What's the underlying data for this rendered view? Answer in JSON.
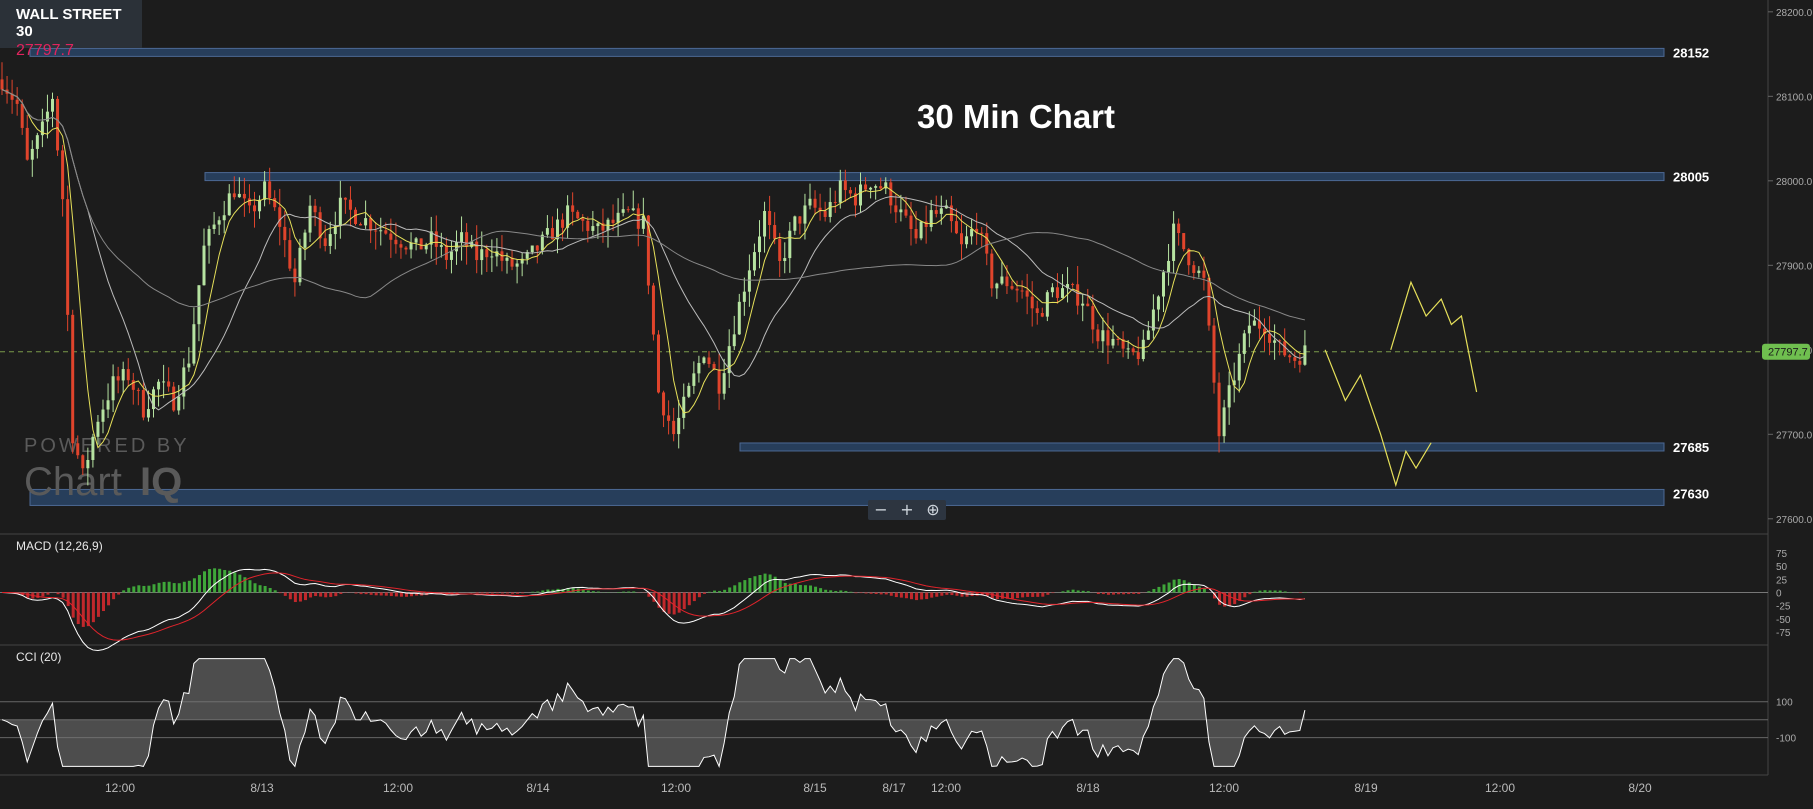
{
  "instrument": {
    "name": "WALL STREET 30",
    "price": "27797.7"
  },
  "chart_title": "30 Min Chart",
  "watermark": {
    "line1": "POWERED BY",
    "line2a": "Chart",
    "line2b": "IQ"
  },
  "zoom_controls": {
    "minus": "−",
    "plus": "+",
    "zoom": "⊕"
  },
  "colors": {
    "background": "#1c1c1c",
    "up_candle": "#b6e3a1",
    "down_candle": "#e0442c",
    "level_fill": "#2a4466",
    "level_stroke": "#5577aa",
    "price_tag": "#6fbf4f",
    "ma_fast": "#e6e05a",
    "ma_slow": "#bbbbbb",
    "macd": "#ffffff",
    "signal": "#e0242c",
    "forecast": "#e6e05a"
  },
  "macd_panel": {
    "label": "MACD (12,26,9)",
    "ticks": [
      "75",
      "50",
      "25",
      "0",
      "-25",
      "-50",
      "-75"
    ]
  },
  "cci_panel": {
    "label": "CCI (20)",
    "ticks": [
      "100",
      "-100"
    ]
  },
  "chart_data": {
    "type": "candlestick",
    "title": "30 Min Chart",
    "instrument": "WALL STREET 30",
    "last_price": 27797.7,
    "y_ticks": [
      "28200.0",
      "28100.0",
      "28000.0",
      "27900.0",
      "27800.0",
      "27700.0",
      "27600.0"
    ],
    "ylim": [
      27582,
      28214
    ],
    "x_ticks": [
      "12:00",
      "8/13",
      "12:00",
      "8/14",
      "12:00",
      "8/15",
      "8/17",
      "12:00",
      "8/18",
      "12:00",
      "8/19",
      "12:00",
      "8/20"
    ],
    "levels": [
      {
        "label": "28152",
        "value": 28152
      },
      {
        "label": "28005",
        "value": 28005
      },
      {
        "label": "27685",
        "value": 27685
      },
      {
        "label": "27630",
        "value": 27630
      }
    ],
    "close_path": [
      [
        0,
        28120
      ],
      [
        3,
        28090
      ],
      [
        5,
        28020
      ],
      [
        8,
        28060
      ],
      [
        10,
        28100
      ],
      [
        12,
        27980
      ],
      [
        14,
        27700
      ],
      [
        16,
        27650
      ],
      [
        19,
        27720
      ],
      [
        22,
        27760
      ],
      [
        25,
        27770
      ],
      [
        28,
        27730
      ],
      [
        31,
        27760
      ],
      [
        34,
        27740
      ],
      [
        37,
        27790
      ],
      [
        40,
        27920
      ],
      [
        43,
        27960
      ],
      [
        46,
        27990
      ],
      [
        49,
        27960
      ],
      [
        52,
        27990
      ],
      [
        55,
        27950
      ],
      [
        58,
        27880
      ],
      [
        61,
        27970
      ],
      [
        64,
        27930
      ],
      [
        67,
        27970
      ],
      [
        70,
        27960
      ],
      [
        73,
        27950
      ],
      [
        76,
        27940
      ],
      [
        79,
        27930
      ],
      [
        82,
        27920
      ],
      [
        85,
        27930
      ],
      [
        88,
        27910
      ],
      [
        91,
        27930
      ],
      [
        94,
        27910
      ],
      [
        97,
        27920
      ],
      [
        100,
        27900
      ],
      [
        103,
        27900
      ],
      [
        106,
        27920
      ],
      [
        109,
        27940
      ],
      [
        112,
        27960
      ],
      [
        115,
        27950
      ],
      [
        118,
        27940
      ],
      [
        121,
        27950
      ],
      [
        124,
        27960
      ],
      [
        127,
        27950
      ],
      [
        130,
        27750
      ],
      [
        133,
        27700
      ],
      [
        136,
        27750
      ],
      [
        139,
        27800
      ],
      [
        142,
        27760
      ],
      [
        145,
        27830
      ],
      [
        148,
        27900
      ],
      [
        151,
        27960
      ],
      [
        154,
        27900
      ],
      [
        157,
        27950
      ],
      [
        160,
        27970
      ],
      [
        163,
        27960
      ],
      [
        166,
        27990
      ],
      [
        169,
        27980
      ],
      [
        172,
        28000
      ],
      [
        175,
        27990
      ],
      [
        178,
        27960
      ],
      [
        181,
        27930
      ],
      [
        184,
        27960
      ],
      [
        187,
        27960
      ],
      [
        190,
        27920
      ],
      [
        193,
        27950
      ],
      [
        196,
        27880
      ],
      [
        199,
        27880
      ],
      [
        202,
        27870
      ],
      [
        205,
        27840
      ],
      [
        208,
        27870
      ],
      [
        211,
        27870
      ],
      [
        214,
        27860
      ],
      [
        217,
        27820
      ],
      [
        220,
        27810
      ],
      [
        223,
        27790
      ],
      [
        226,
        27800
      ],
      [
        229,
        27870
      ],
      [
        232,
        27940
      ],
      [
        235,
        27910
      ],
      [
        238,
        27880
      ],
      [
        241,
        27700
      ],
      [
        244,
        27770
      ],
      [
        247,
        27830
      ],
      [
        250,
        27830
      ],
      [
        253,
        27800
      ],
      [
        256,
        27790
      ],
      [
        258,
        27798
      ]
    ],
    "forecast_path": [
      [
        262,
        27800
      ],
      [
        266,
        27740
      ],
      [
        269,
        27770
      ],
      [
        273,
        27700
      ],
      [
        276,
        27640
      ],
      [
        278,
        27680
      ],
      [
        280,
        27660
      ],
      [
        283,
        27690
      ]
    ],
    "forecast_path_2": [
      [
        275,
        27800
      ],
      [
        279,
        27880
      ],
      [
        282,
        27840
      ],
      [
        285,
        27860
      ],
      [
        287,
        27830
      ],
      [
        289,
        27840
      ],
      [
        292,
        27750
      ]
    ],
    "macd_ylim": [
      -90,
      90
    ],
    "cci_ylim": [
      -280,
      360
    ]
  }
}
